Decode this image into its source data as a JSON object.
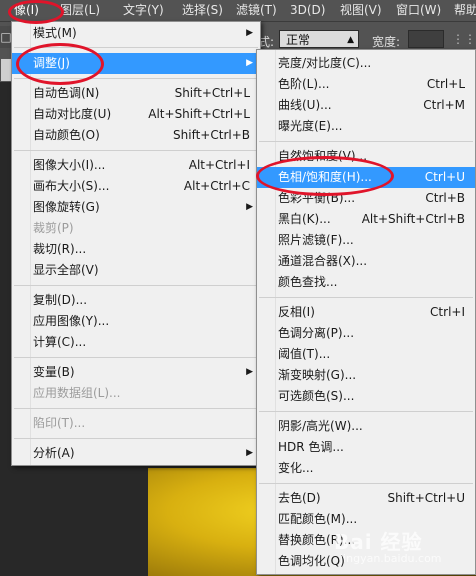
{
  "menubar": {
    "items": [
      {
        "label": "像(I)"
      },
      {
        "label": "图层(L)"
      },
      {
        "label": "文字(Y)"
      },
      {
        "label": "选择(S)"
      },
      {
        "label": "滤镜(T)"
      },
      {
        "label": "3D(D)"
      },
      {
        "label": "视图(V)"
      },
      {
        "label": "窗口(W)"
      },
      {
        "label": "帮助"
      }
    ]
  },
  "options_bar": {
    "style_label": "式:",
    "style_value": "正常",
    "width_label": "宽度:",
    "left_glyph": "□"
  },
  "image_menu": {
    "items": [
      {
        "label": "模式(M)",
        "shortcut": "",
        "submenu": true,
        "disabled": false
      },
      {
        "label": "调整(J)",
        "shortcut": "",
        "submenu": true,
        "disabled": false
      },
      {
        "label": "自动色调(N)",
        "shortcut": "Shift+Ctrl+L",
        "submenu": false,
        "disabled": false
      },
      {
        "label": "自动对比度(U)",
        "shortcut": "Alt+Shift+Ctrl+L",
        "submenu": false,
        "disabled": false
      },
      {
        "label": "自动颜色(O)",
        "shortcut": "Shift+Ctrl+B",
        "submenu": false,
        "disabled": false
      },
      {
        "label": "图像大小(I)...",
        "shortcut": "Alt+Ctrl+I",
        "submenu": false,
        "disabled": false
      },
      {
        "label": "画布大小(S)...",
        "shortcut": "Alt+Ctrl+C",
        "submenu": false,
        "disabled": false
      },
      {
        "label": "图像旋转(G)",
        "shortcut": "",
        "submenu": true,
        "disabled": false
      },
      {
        "label": "裁剪(P)",
        "shortcut": "",
        "submenu": false,
        "disabled": true
      },
      {
        "label": "裁切(R)...",
        "shortcut": "",
        "submenu": false,
        "disabled": false
      },
      {
        "label": "显示全部(V)",
        "shortcut": "",
        "submenu": false,
        "disabled": false
      },
      {
        "label": "复制(D)...",
        "shortcut": "",
        "submenu": false,
        "disabled": false
      },
      {
        "label": "应用图像(Y)...",
        "shortcut": "",
        "submenu": false,
        "disabled": false
      },
      {
        "label": "计算(C)...",
        "shortcut": "",
        "submenu": false,
        "disabled": false
      },
      {
        "label": "变量(B)",
        "shortcut": "",
        "submenu": true,
        "disabled": false
      },
      {
        "label": "应用数据组(L)...",
        "shortcut": "",
        "submenu": false,
        "disabled": true
      },
      {
        "label": "陷印(T)...",
        "shortcut": "",
        "submenu": false,
        "disabled": true
      },
      {
        "label": "分析(A)",
        "shortcut": "",
        "submenu": true,
        "disabled": false
      }
    ]
  },
  "adjust_menu": {
    "items": [
      {
        "label": "亮度/对比度(C)...",
        "shortcut": ""
      },
      {
        "label": "色阶(L)...",
        "shortcut": "Ctrl+L"
      },
      {
        "label": "曲线(U)...",
        "shortcut": "Ctrl+M"
      },
      {
        "label": "曝光度(E)...",
        "shortcut": ""
      },
      {
        "label": "自然饱和度(V)...",
        "shortcut": ""
      },
      {
        "label": "色相/饱和度(H)...",
        "shortcut": "Ctrl+U"
      },
      {
        "label": "色彩平衡(B)...",
        "shortcut": "Ctrl+B"
      },
      {
        "label": "黑白(K)...",
        "shortcut": "Alt+Shift+Ctrl+B"
      },
      {
        "label": "照片滤镜(F)...",
        "shortcut": ""
      },
      {
        "label": "通道混合器(X)...",
        "shortcut": ""
      },
      {
        "label": "颜色查找...",
        "shortcut": ""
      },
      {
        "label": "反相(I)",
        "shortcut": "Ctrl+I"
      },
      {
        "label": "色调分离(P)...",
        "shortcut": ""
      },
      {
        "label": "阈值(T)...",
        "shortcut": ""
      },
      {
        "label": "渐变映射(G)...",
        "shortcut": ""
      },
      {
        "label": "可选颜色(S)...",
        "shortcut": ""
      },
      {
        "label": "阴影/高光(W)...",
        "shortcut": ""
      },
      {
        "label": "HDR 色调...",
        "shortcut": ""
      },
      {
        "label": "变化...",
        "shortcut": ""
      },
      {
        "label": "去色(D)",
        "shortcut": "Shift+Ctrl+U"
      },
      {
        "label": "匹配颜色(M)...",
        "shortcut": ""
      },
      {
        "label": "替换颜色(R)...",
        "shortcut": ""
      },
      {
        "label": "色调均化(Q)",
        "shortcut": ""
      }
    ]
  },
  "watermark": {
    "main": "Bai 经验",
    "sub": "jingyan.baidu.com"
  },
  "colors": {
    "highlight": "#3399ff",
    "annotation": "#e0142a",
    "menu_bg": "#f0f0f0"
  }
}
